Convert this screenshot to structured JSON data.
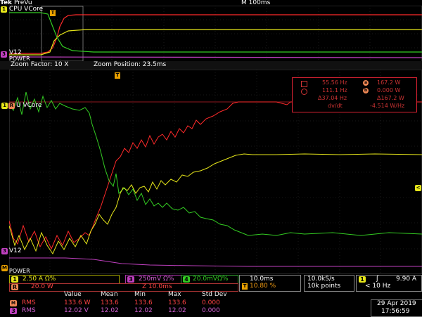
{
  "topbar": {
    "brand": "Tek",
    "mode": "PreVu",
    "timebase": "M 100ms"
  },
  "overview": {
    "labels": {
      "cpu": "CPU VCore",
      "v12": "V12",
      "power": "POWER"
    }
  },
  "zoom": {
    "factor": "Zoom Factor: 10 X",
    "position": "Zoom Position: 23.5ms"
  },
  "main": {
    "labels": {
      "cpu": "U VCore",
      "v12": "V12",
      "power": "POWER"
    },
    "channels": {
      "ch1": "1",
      "ch3": "3",
      "ch4": "4",
      "r": "R",
      "m": "M"
    }
  },
  "measurement": {
    "row1_left": "55.56 Hz",
    "row1_right": "167.2 W",
    "row2_left": "111.1 Hz",
    "row2_right": "0.000 W",
    "row3_left": "Δ37.04 Hz",
    "row3_right": "Δ167.2 W",
    "row4_left": "dv/dt",
    "row4_right": "-4.514 W/Hz",
    "badge_a": "a",
    "badge_b": "b"
  },
  "bottom": {
    "ch1_scale": "2.50 A  Ω%",
    "ch3_scale": "250mV Ω%",
    "ch4_scale": "20.0mVΩ%",
    "r_scale": "20.0 W",
    "z_scale": "Z 10.0ms",
    "time_div": "10.0ms",
    "time_pct": "10.80 %",
    "sample_rate": "10.0kS/s",
    "points": "10k points",
    "trigger_slope": "ʃ",
    "trigger_level": "9.90 A",
    "trigger_freq": "< 10 Hz"
  },
  "stats": {
    "headers": [
      "Value",
      "Mean",
      "Min",
      "Max",
      "Std Dev"
    ],
    "rows": [
      {
        "label": "RMS",
        "value": "133.6 W",
        "mean": "133.6",
        "min": "133.6",
        "max": "133.6",
        "std": "0.000"
      },
      {
        "label": "RMS",
        "value": "12.02 V",
        "mean": "12.02",
        "min": "12.02",
        "max": "12.02",
        "std": "0.000"
      }
    ]
  },
  "datetime": {
    "date": "29 Apr 2019",
    "time": "17:56:59"
  },
  "colors": {
    "red": "#ff2a2a",
    "yellow": "#e6e61a",
    "green": "#33cc22",
    "magenta": "#c040c0",
    "orange": "#f39c12"
  }
}
